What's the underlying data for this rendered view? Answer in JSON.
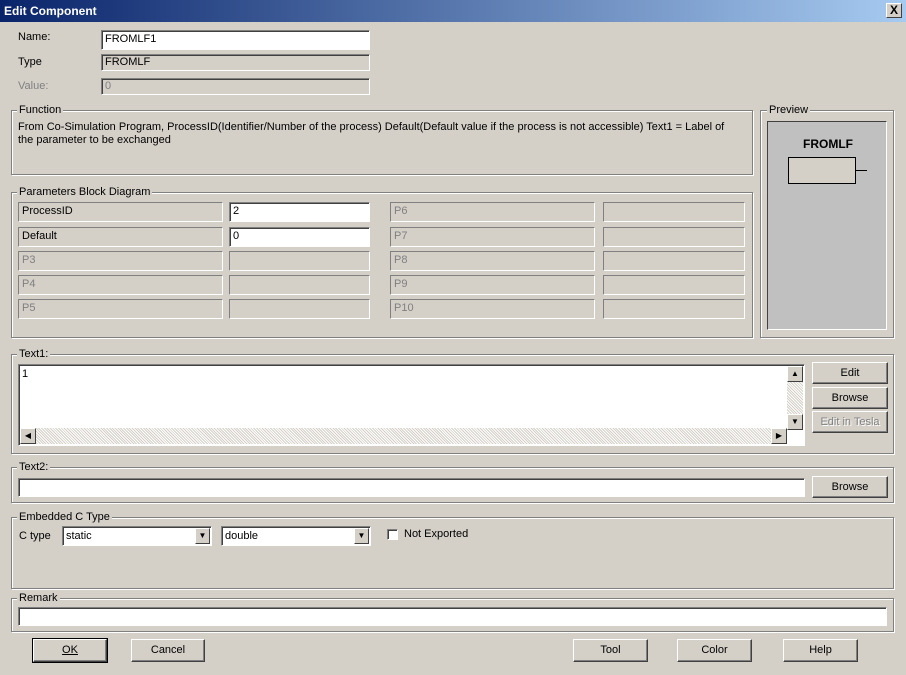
{
  "window": {
    "title": "Edit Component",
    "close_glyph": "X"
  },
  "name": {
    "label": "Name:",
    "value": "FROMLF1"
  },
  "type": {
    "label": "Type",
    "value": "FROMLF"
  },
  "value": {
    "label": "Value:",
    "value": "0"
  },
  "function": {
    "legend": "Function",
    "text": "From Co-Simulation Program, ProcessID(Identifier/Number of the process) Default(Default value if the process is not accessible) Text1 = Label of the parameter to be exchanged"
  },
  "preview": {
    "legend": "Preview",
    "block_title": "FROMLF"
  },
  "params": {
    "legend": "Parameters Block Diagram",
    "left": [
      {
        "label": "ProcessID",
        "value": "2"
      },
      {
        "label": "Default",
        "value": "0"
      },
      {
        "label": "P3",
        "value": ""
      },
      {
        "label": "P4",
        "value": ""
      },
      {
        "label": "P5",
        "value": ""
      }
    ],
    "right": [
      {
        "label": "P6",
        "value": ""
      },
      {
        "label": "P7",
        "value": ""
      },
      {
        "label": "P8",
        "value": ""
      },
      {
        "label": "P9",
        "value": ""
      },
      {
        "label": "P10",
        "value": ""
      }
    ]
  },
  "text1": {
    "legend": "Text1:",
    "value": "1",
    "edit": "Edit",
    "browse": "Browse",
    "edit_in_tesla": "Edit in Tesla"
  },
  "text2": {
    "legend": "Text2:",
    "value": "",
    "browse": "Browse"
  },
  "embedded": {
    "legend": "Embedded C Type",
    "ctype_label": "C type",
    "storage": "static",
    "datatype": "double",
    "not_exported": "Not Exported"
  },
  "remark": {
    "legend": "Remark",
    "value": ""
  },
  "buttons": {
    "ok": "OK",
    "cancel": "Cancel",
    "tool": "Tool",
    "color": "Color",
    "help": "Help"
  }
}
